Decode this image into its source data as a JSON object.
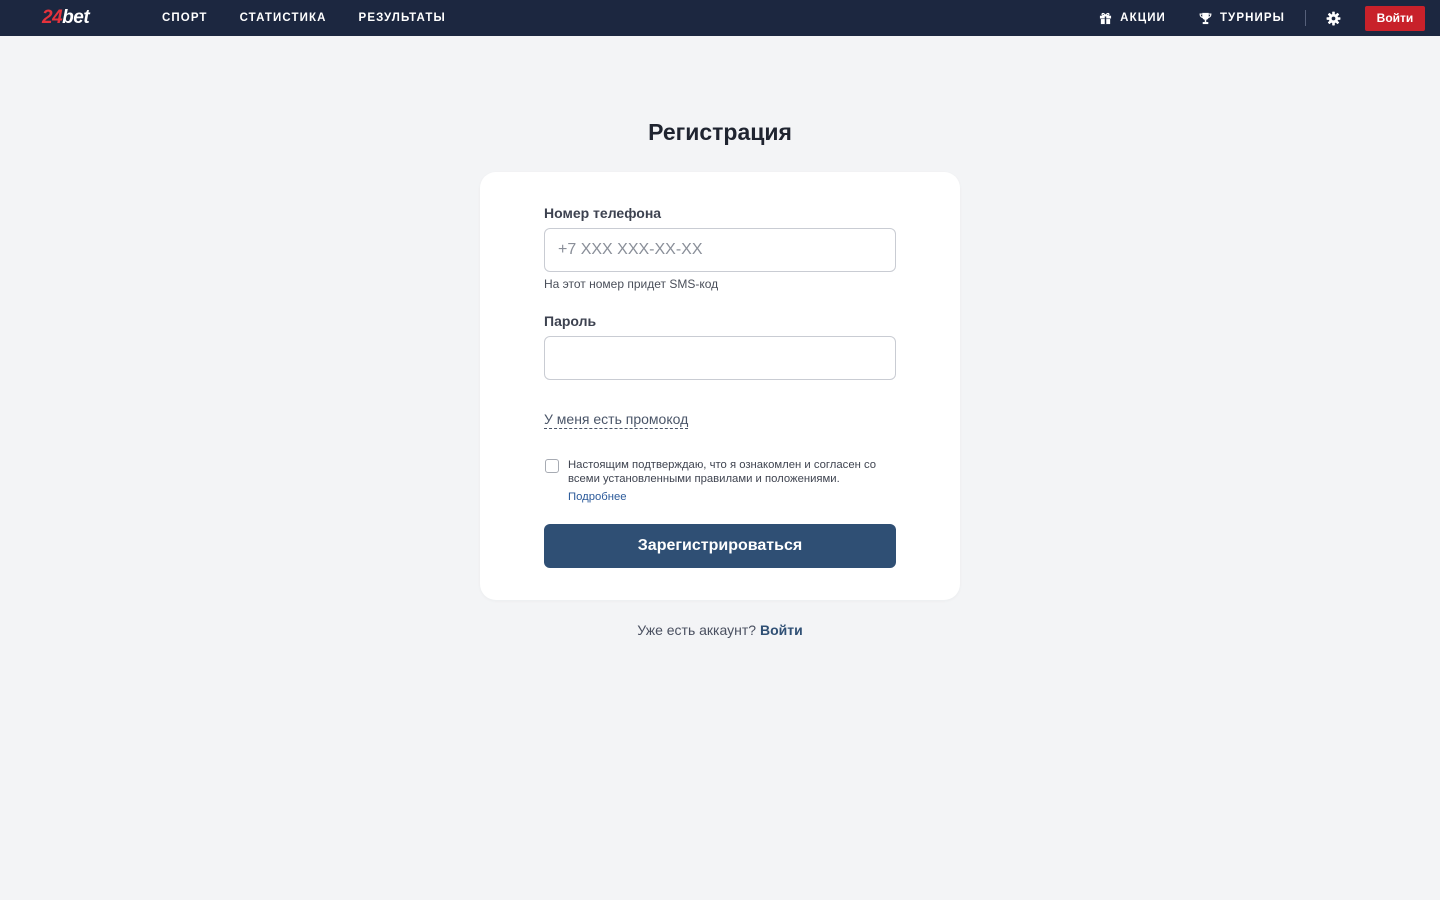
{
  "brand": {
    "logo_num": "24",
    "logo_word": "bet",
    "accent": "#e4323c",
    "navbar_bg": "#1c2740"
  },
  "nav": {
    "left": [
      {
        "label": "СПОРТ"
      },
      {
        "label": "СТАТИСТИКА"
      },
      {
        "label": "РЕЗУЛЬТАТЫ"
      }
    ],
    "promotions_label": "АКЦИИ",
    "tournaments_label": "ТУРНИРЫ",
    "login_label": "Войти",
    "login_color": "#c8212a"
  },
  "page": {
    "title": "Регистрация"
  },
  "form": {
    "phone_label": "Номер телефона",
    "phone_placeholder": "+7 XXX XXX-XX-XX",
    "phone_value": "",
    "phone_hint": "На этот номер придет SMS-код",
    "password_label": "Пароль",
    "password_value": "",
    "promo_link": "У меня есть промокод",
    "agree_text": "Настоящим подтверждаю, что я ознакомлен и согласен со всеми установленными правилами и положениями.",
    "agree_checked": false,
    "agree_more": "Подробнее",
    "submit_label": "Зарегистрироваться",
    "submit_color": "#2f4f74"
  },
  "footer": {
    "question": "Уже есть аккаунт?",
    "login_link": "Войти"
  },
  "icons": {
    "promotions": "gift-icon",
    "tournaments": "trophy-icon",
    "settings": "gear-icon"
  }
}
